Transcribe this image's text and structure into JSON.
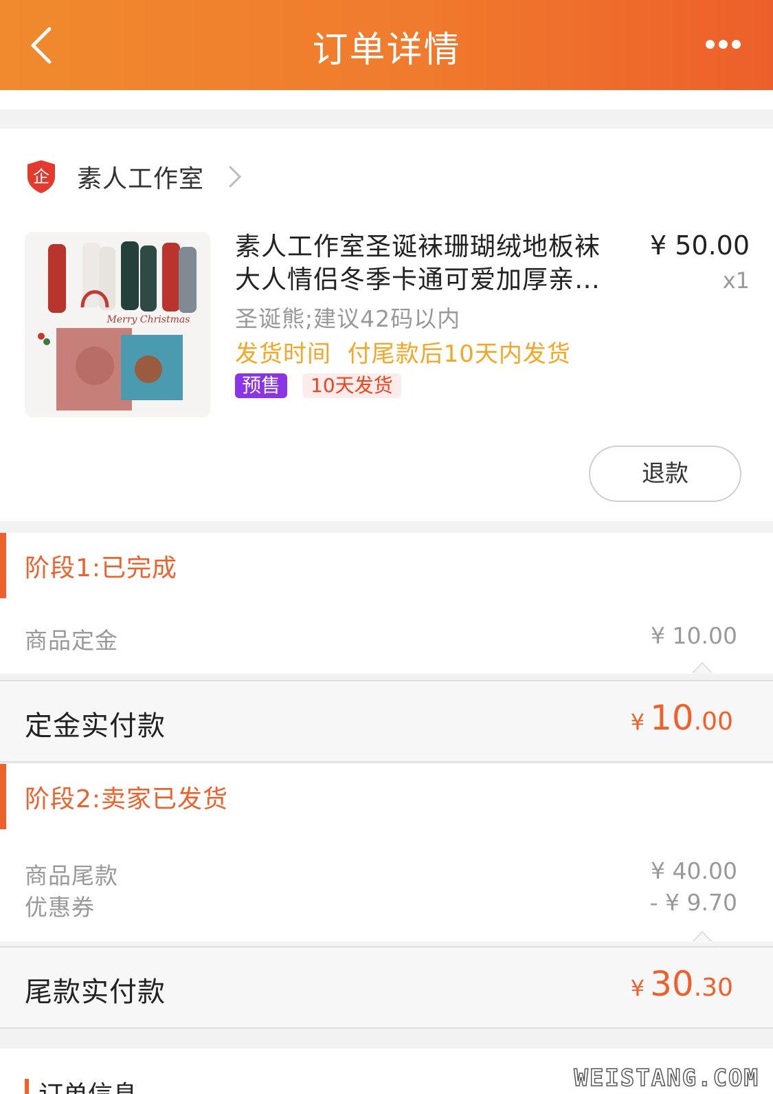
{
  "header": {
    "title": "订单详情"
  },
  "shop": {
    "name": "素人工作室",
    "badge_char": "企"
  },
  "product": {
    "title": "素人工作室圣诞袜珊瑚绒地板袜大人情侣冬季卡通可爱加厚亲子袜",
    "price": "¥ 50.00",
    "qty": "x1",
    "sku": "圣诞熊;建议42码以内",
    "ship_time": "发货时间  付尾款后10天内发货",
    "tag_presale": "预售",
    "tag_days": "10天发货",
    "image_text": "Merry Christmas"
  },
  "refund_label": "退款",
  "stage1": {
    "title": "阶段1:已完成",
    "rows": [
      {
        "label": "商品定金",
        "value": "¥ 10.00"
      }
    ],
    "pay_label": "定金实付款",
    "pay_symbol": "¥",
    "pay_int": "10",
    "pay_dec": ".00"
  },
  "stage2": {
    "title": "阶段2:卖家已发货",
    "rows": [
      {
        "label": "商品尾款",
        "value": "¥ 40.00"
      },
      {
        "label": "优惠券",
        "value": "- ¥ 9.70"
      }
    ],
    "pay_label": "尾款实付款",
    "pay_symbol": "¥",
    "pay_int": "30",
    "pay_dec": ".30"
  },
  "order_info": {
    "title": "订单信息"
  },
  "watermark": "WEISTANG.COM",
  "colors": {
    "header_start": "#f08a2e",
    "header_end": "#ed5f2a",
    "accent": "#f0602a",
    "ship_text": "#f5a623",
    "presale_tag": "#8a34e6"
  },
  "icons": [
    "back-chevron-icon",
    "more-dots-icon",
    "shop-shield-icon",
    "chevron-right-icon",
    "caret-up-icon"
  ]
}
